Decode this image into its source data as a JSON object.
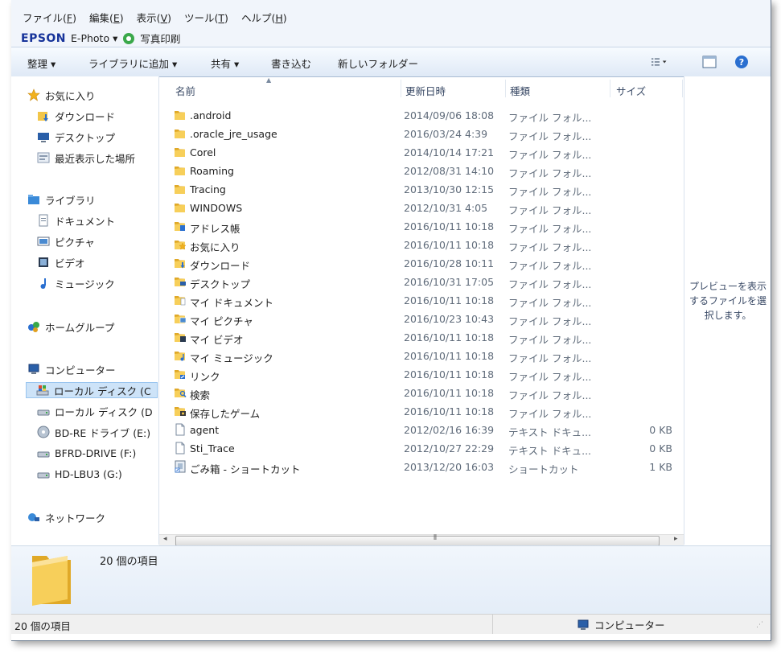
{
  "menu": {
    "items": [
      {
        "label": "ファイル(",
        "key": "F",
        "tail": ")"
      },
      {
        "label": "編集(",
        "key": "E",
        "tail": ")"
      },
      {
        "label": "表示(",
        "key": "V",
        "tail": ")"
      },
      {
        "label": "ツール(",
        "key": "T",
        "tail": ")"
      },
      {
        "label": "ヘルプ(",
        "key": "H",
        "tail": ")"
      }
    ],
    "epson_brand": "EPSON",
    "epson_product": "E-Photo",
    "epson_print": "写真印刷"
  },
  "toolbar": {
    "organize": "整理 ▾",
    "add_library": "ライブラリに追加 ▾",
    "share": "共有 ▾",
    "burn": "書き込む",
    "new_folder": "新しいフォルダー"
  },
  "nav": {
    "favorites": "お気に入り",
    "downloads": "ダウンロード",
    "desktop": "デスクトップ",
    "recent": "最近表示した場所",
    "libraries": "ライブラリ",
    "documents": "ドキュメント",
    "pictures": "ピクチャ",
    "videos": "ビデオ",
    "music": "ミュージック",
    "homegroup": "ホームグループ",
    "computer": "コンピューター",
    "drive_c": "ローカル ディスク (C",
    "drive_d": "ローカル ディスク (D",
    "drive_e": "BD-RE ドライブ (E:)",
    "drive_f": "BFRD-DRIVE (F:)",
    "drive_g": "HD-LBU3 (G:)",
    "network": "ネットワーク"
  },
  "columns": {
    "name": "名前",
    "date": "更新日時",
    "type": "種類",
    "size": "サイズ"
  },
  "files": [
    {
      "name": ".android",
      "date": "2014/09/06 18:08",
      "type": "ファイル フォル...",
      "size": "",
      "icon": "folder-icon"
    },
    {
      "name": ".oracle_jre_usage",
      "date": "2016/03/24 4:39",
      "type": "ファイル フォル...",
      "size": "",
      "icon": "folder-icon"
    },
    {
      "name": "Corel",
      "date": "2014/10/14 17:21",
      "type": "ファイル フォル...",
      "size": "",
      "icon": "folder-icon"
    },
    {
      "name": "Roaming",
      "date": "2012/08/31 14:10",
      "type": "ファイル フォル...",
      "size": "",
      "icon": "folder-icon"
    },
    {
      "name": "Tracing",
      "date": "2013/10/30 12:15",
      "type": "ファイル フォル...",
      "size": "",
      "icon": "folder-icon"
    },
    {
      "name": "WINDOWS",
      "date": "2012/10/31 4:05",
      "type": "ファイル フォル...",
      "size": "",
      "icon": "folder-icon"
    },
    {
      "name": "アドレス帳",
      "date": "2016/10/11 10:18",
      "type": "ファイル フォル...",
      "size": "",
      "icon": "contacts-folder-icon"
    },
    {
      "name": "お気に入り",
      "date": "2016/10/11 10:18",
      "type": "ファイル フォル...",
      "size": "",
      "icon": "favorites-folder-icon"
    },
    {
      "name": "ダウンロード",
      "date": "2016/10/28 10:11",
      "type": "ファイル フォル...",
      "size": "",
      "icon": "downloads-folder-icon"
    },
    {
      "name": "デスクトップ",
      "date": "2016/10/31 17:05",
      "type": "ファイル フォル...",
      "size": "",
      "icon": "desktop-folder-icon"
    },
    {
      "name": "マイ ドキュメント",
      "date": "2016/10/11 10:18",
      "type": "ファイル フォル...",
      "size": "",
      "icon": "documents-folder-icon"
    },
    {
      "name": "マイ ピクチャ",
      "date": "2016/10/23 10:43",
      "type": "ファイル フォル...",
      "size": "",
      "icon": "pictures-folder-icon"
    },
    {
      "name": "マイ ビデオ",
      "date": "2016/10/11 10:18",
      "type": "ファイル フォル...",
      "size": "",
      "icon": "videos-folder-icon"
    },
    {
      "name": "マイ ミュージック",
      "date": "2016/10/11 10:18",
      "type": "ファイル フォル...",
      "size": "",
      "icon": "music-folder-icon"
    },
    {
      "name": "リンク",
      "date": "2016/10/11 10:18",
      "type": "ファイル フォル...",
      "size": "",
      "icon": "links-folder-icon"
    },
    {
      "name": "検索",
      "date": "2016/10/11 10:18",
      "type": "ファイル フォル...",
      "size": "",
      "icon": "search-folder-icon"
    },
    {
      "name": "保存したゲーム",
      "date": "2016/10/11 10:18",
      "type": "ファイル フォル...",
      "size": "",
      "icon": "games-folder-icon"
    },
    {
      "name": "agent",
      "date": "2012/02/16 16:39",
      "type": "テキスト ドキュ...",
      "size": "0 KB",
      "icon": "text-file-icon"
    },
    {
      "name": "Sti_Trace",
      "date": "2012/10/27 22:29",
      "type": "テキスト ドキュ...",
      "size": "0 KB",
      "icon": "text-file-icon"
    },
    {
      "name": "ごみ箱 - ショートカット",
      "date": "2013/12/20 16:03",
      "type": "ショートカット",
      "size": "1 KB",
      "icon": "shortcut-icon"
    }
  ],
  "preview": {
    "message": "プレビューを表示するファイルを選択します。"
  },
  "details": {
    "count": "20 個の項目"
  },
  "status": {
    "left": "20 個の項目",
    "right": "コンピューター"
  },
  "colors": {
    "folder": "#f2c64a",
    "selection": "#cde3f8",
    "link": "#16339a"
  }
}
